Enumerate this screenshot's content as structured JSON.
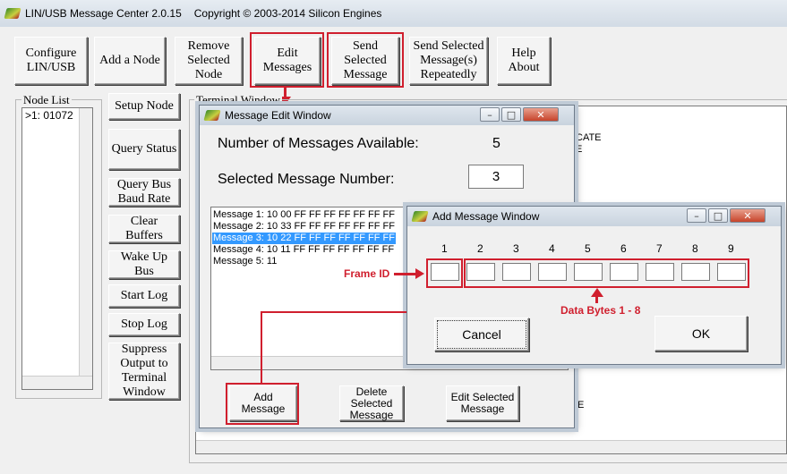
{
  "app": {
    "title": "LIN/USB Message Center 2.0.15",
    "copyright": "Copyright © 2003-2014 Silicon Engines",
    "icon": "app-logo-icon"
  },
  "toolbar": {
    "configure": "Configure\nLIN/USB",
    "add_node": "Add a Node",
    "remove_node": "Remove\nSelected\nNode",
    "edit_messages": "Edit\nMessages",
    "send_selected": "Send\nSelected\nMessage",
    "send_repeat": "Send Selected\nMessage(s)\nRepeatedly",
    "help_about": "Help\nAbout"
  },
  "node_list": {
    "label": "Node List",
    "items": [
      ">1: 01072"
    ]
  },
  "side_buttons": {
    "setup_node": "Setup Node",
    "query_status": "Query Status",
    "query_baud": "Query Bus\nBaud Rate",
    "clear_buffers": "Clear\nBuffers",
    "wake_up": "Wake Up\nBus",
    "start_log": "Start Log",
    "stop_log": "Stop Log",
    "suppress": "Suppress\nOutput to\nTerminal\nWindow"
  },
  "terminal": {
    "label": "Terminal Window",
    "fragments": [
      "CATE",
      "E",
      "E"
    ]
  },
  "message_edit": {
    "title": "Message Edit Window",
    "available_label": "Number of Messages Available:",
    "available_value": "5",
    "selected_label": "Selected Message Number:",
    "selected_value": "3",
    "messages": [
      "Message 1: 10 00 FF FF FF FF FF FF FF",
      "Message 2: 10 33 FF FF FF FF FF FF FF",
      "Message 3: 10 22 FF FF FF FF FF FF FF",
      "Message 4: 10 11 FF FF FF FF FF FF FF",
      "Message 5: 11"
    ],
    "selected_index": 2,
    "add_button": "Add\nMessage",
    "delete_button": "Delete\nSelected\nMessage",
    "edit_button": "Edit Selected\nMessage"
  },
  "add_message": {
    "title": "Add Message Window",
    "column_numbers": [
      "1",
      "2",
      "3",
      "4",
      "5",
      "6",
      "7",
      "8",
      "9"
    ],
    "cancel": "Cancel",
    "ok": "OK"
  },
  "annotations": {
    "frame_id": "Frame ID",
    "data_bytes": "Data Bytes 1 - 8",
    "color": "#d01f2e"
  },
  "window_controls": {
    "minimize": "–",
    "maximize": "□",
    "close": "✕"
  }
}
